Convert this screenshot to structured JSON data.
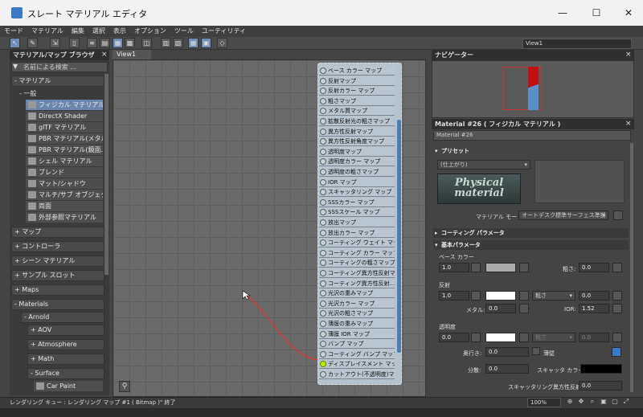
{
  "window": {
    "title": "スレート マテリアル エディタ",
    "min": "—",
    "max": "☐",
    "close": "✕"
  },
  "menu": [
    "モード",
    "マテリアル",
    "編集",
    "選択",
    "表示",
    "オプション",
    "ツール",
    "ユーティリティ"
  ],
  "toolbar": {
    "view_select": "View1"
  },
  "browser": {
    "title": "マテリアル/マップ ブラウザ",
    "close": "×",
    "search_placeholder": "名前による検索 ...",
    "sections": {
      "materials": "- マテリアル",
      "general": "- 一般",
      "items": [
        "フィジカル マテリアル",
        "DirectX Shader",
        "glTF マテリアル",
        "PBR マテリアル(メタル...",
        "PBR マテリアル(鏡面...",
        "シェル マテリアル",
        "ブレンド",
        "マット/シャドウ",
        "マルチ/サブ オブジェクト",
        "両面",
        "外部参照マテリアル"
      ],
      "maps": "+ マップ",
      "controllers": "+ コントローラ",
      "scene_materials": "+ シーン マテリアル",
      "sample_slots": "+ サンプル スロット",
      "maps_en": "+ Maps",
      "materials_en": "- Materials",
      "arnold": "- Arnold",
      "aov": "+ AOV",
      "atmosphere": "+ Atmosphere",
      "math": "+ Math",
      "surface": "- Surface",
      "car_paint": "Car Paint"
    }
  },
  "view": {
    "tab": "View1"
  },
  "node": {
    "slots": [
      "ベース カラー マップ",
      "反射マップ",
      "反射カラー マップ",
      "粗さマップ",
      "メタル質マップ",
      "拡散反射光の粗さマップ",
      "異方性反射マップ",
      "異方性反射角度マップ",
      "透明度マップ",
      "透明度カラー マップ",
      "透明度の粗さマップ",
      "IOR マップ",
      "スキャッタリング マップ",
      "SSSカラー マップ",
      "SSSスケール マップ",
      "放出マップ",
      "放出カラー マップ",
      "コーティング ウェイト マップ",
      "コーティング カラー マップ",
      "コーティングの粗さマップ",
      "コーティング異方性反射マ...",
      "コーティング異方性反射...",
      "光沢の重みマップ",
      "光沢カラー マップ",
      "光沢の粗さマップ",
      "薄膜の重みマップ",
      "薄膜 IOR マップ",
      "バンプ マップ",
      "コーティング バンプ マップ",
      "ディスプレイスメント マップ",
      "カットアウト(不透明度)マップ"
    ],
    "highlighted_slot": 29
  },
  "navigator": {
    "title": "ナビゲーター",
    "close": "×"
  },
  "material": {
    "header": "Material #26  ( フィジカル マテリアル )",
    "name": "Material #26",
    "preset_title": "プリセット",
    "preset_value": "(仕上がり)",
    "logo_line1": "Physical",
    "logo_line2": "material",
    "mode_label": "マテリアル モード:",
    "mode_value": "オートデスク標準サーフェス準拠",
    "coating_title": "コーティング パラメータ",
    "basic_title": "基本パラメータ",
    "base_color_label": "ベース カラー",
    "base_weight": "1.0",
    "roughness_label": "粗さ:",
    "base_roughness": "0.0",
    "reflection_label": "反射",
    "refl_weight": "1.0",
    "refl_mode": "粗さ",
    "refl_rough": "0.0",
    "metal_label": "メタル:",
    "metal_value": "0.0",
    "ior_label": "IOR:",
    "ior_value": "1.52",
    "transparency_label": "透明度",
    "trans_weight": "0.0",
    "trans_mode": "粗さ",
    "trans_rough": "0.0",
    "depth_label": "奥行き:",
    "depth_value": "0.0",
    "thin_label": "薄壁",
    "dispersion_label": "分散:",
    "dispersion_value": "0.0",
    "scatter_color_label": "スキャッタ カラー:",
    "sss_aniso_label": "スキャッタリング異方性反射:",
    "sss_aniso_value": "0.0"
  },
  "status": {
    "text": "レンダリング キュー :    レンダリング マップ #1 ( Bitmap )\" 終了",
    "zoom": "100%"
  },
  "colors": {
    "accent": "#6b86ad",
    "highlight_dot": "#b6f000",
    "wire": "#d23a3a"
  }
}
